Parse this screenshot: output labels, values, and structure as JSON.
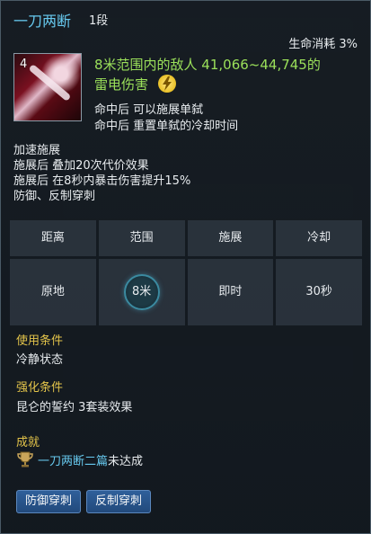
{
  "skill": {
    "name": "一刀两断",
    "level": "1段",
    "hp_cost": "生命消耗 3%",
    "icon_number": "4",
    "damage_line1": "8米范围内的敌人 41,066~44,745的",
    "damage_line2": "雷电伤害",
    "effects": [
      "命中后 可以施展单弑",
      "命中后 重置单弑的冷却时间"
    ],
    "buffs": [
      "加速施展",
      "施展后 叠加20次代价效果",
      "施展后 在8秒内暴击伤害提升15%",
      "防御、反制穿刺"
    ]
  },
  "stats": {
    "headers": [
      "距离",
      "范围",
      "施展",
      "冷却"
    ],
    "values": [
      "原地",
      "8米",
      "即时",
      "30秒"
    ]
  },
  "usage": {
    "label": "使用条件",
    "text": "冷静状态"
  },
  "upgrade": {
    "label": "强化条件",
    "text": "昆仑的誓约 3套装效果"
  },
  "achievement": {
    "label": "成就",
    "name": "一刀两断二篇",
    "status": "未达成"
  },
  "tags": [
    "防御穿刺",
    "反制穿刺"
  ],
  "colors": {
    "title": "#67c9ef",
    "damage": "#9be05a",
    "section": "#e3c44a",
    "tag": "#2f5f9a"
  },
  "icons": {
    "element": "lightning-icon",
    "achievement": "trophy-icon"
  }
}
